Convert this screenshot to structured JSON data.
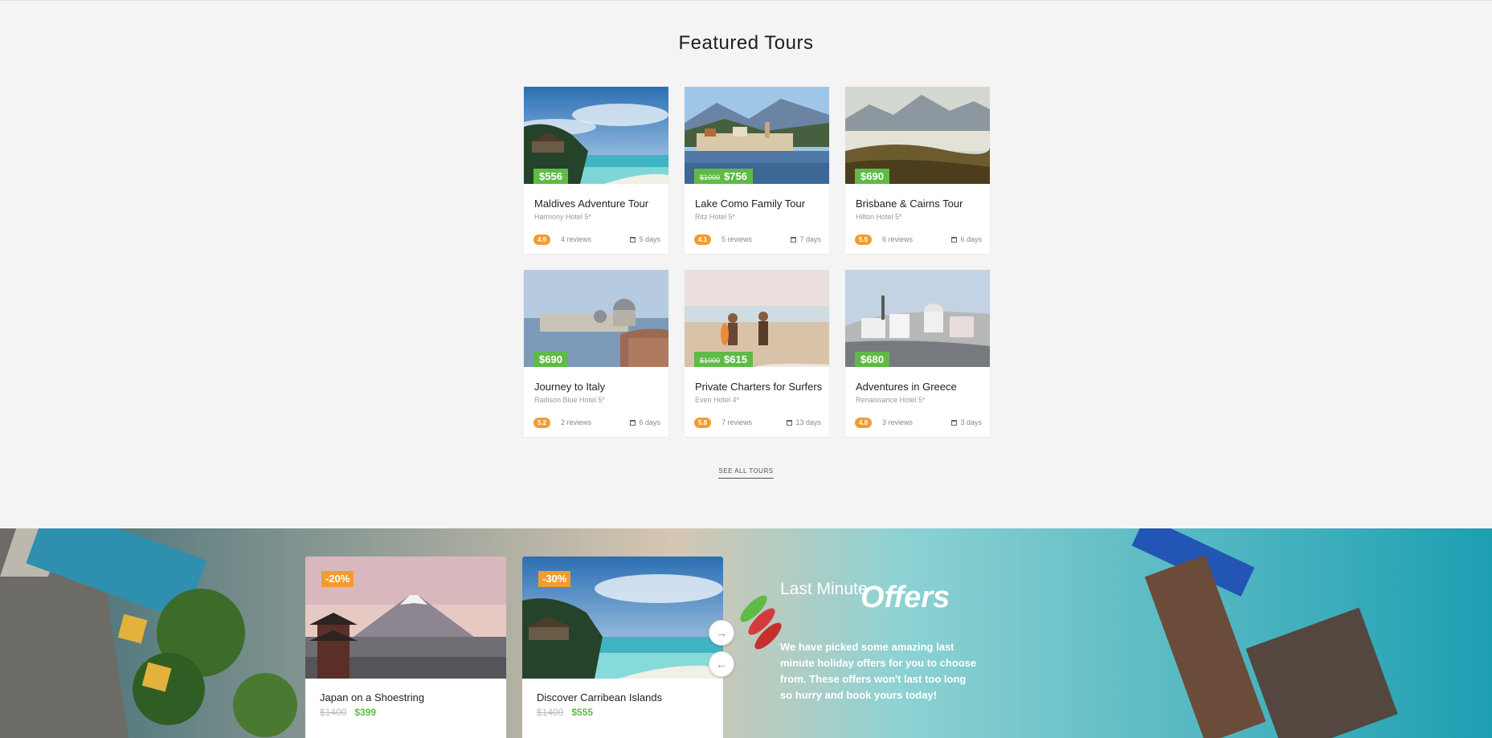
{
  "featured": {
    "title": "Featured Tours",
    "see_all": "SEE ALL TOURS",
    "tours": [
      {
        "title": "Maldives Adventure Tour",
        "hotel": "Harmony Hotel 5*",
        "price": "$556",
        "old_price": "",
        "rating": "4.9",
        "reviews": "4 reviews",
        "days": "5 days"
      },
      {
        "title": "Lake Como Family Tour",
        "hotel": "Ritz Hotel 5*",
        "price": "$756",
        "old_price": "$1000",
        "rating": "4.1",
        "reviews": "5 reviews",
        "days": "7 days"
      },
      {
        "title": "Brisbane & Cairns Tour",
        "hotel": "Hilton Hotel 5*",
        "price": "$690",
        "old_price": "",
        "rating": "5.5",
        "reviews": "6 reviews",
        "days": "6 days"
      },
      {
        "title": "Journey to Italy",
        "hotel": "Radison Blue Hotel 5*",
        "price": "$690",
        "old_price": "",
        "rating": "5.2",
        "reviews": "2 reviews",
        "days": "6 days"
      },
      {
        "title": "Private Charters for Surfers",
        "hotel": "Even Hotel 4*",
        "price": "$615",
        "old_price": "$1000",
        "rating": "5.8",
        "reviews": "7 reviews",
        "days": "13 days"
      },
      {
        "title": "Adventures in Greece",
        "hotel": "Renaissance Hotel 5*",
        "price": "$680",
        "old_price": "",
        "rating": "4.8",
        "reviews": "3 reviews",
        "days": "3 days"
      }
    ]
  },
  "offers": {
    "heading_small": "Last Minute",
    "heading_big": "Offers",
    "description": "We have picked some amazing last minute holiday offers for you to choose from. These offers won't last too long so hurry and book yours today!",
    "next_icon": "arrow-right-icon",
    "prev_icon": "arrow-left-icon",
    "cards": [
      {
        "title": "Japan on a Shoestring",
        "discount": "-20%",
        "old_price": "$1400",
        "price": "$399"
      },
      {
        "title": "Discover Carribean Islands",
        "discount": "-30%",
        "old_price": "$1400",
        "price": "$555"
      }
    ]
  },
  "colors": {
    "price_green": "#5fba46",
    "rating_orange": "#f39c2d",
    "background": "#f4f4f4"
  }
}
